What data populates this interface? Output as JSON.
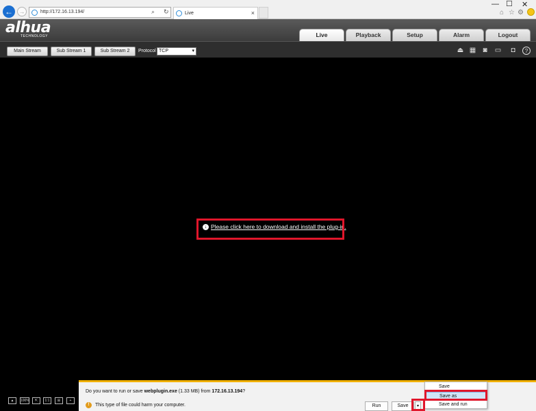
{
  "browser": {
    "url": "http://172.16.13.194/",
    "tab_title": "Live",
    "tab_close": "×",
    "back_glyph": "←",
    "forward_glyph": "→",
    "search_glyph": "⌕",
    "refresh_glyph": "↻",
    "min_glyph": "—",
    "max_glyph": "☐",
    "close_glyph": "✕",
    "home_glyph": "⌂",
    "star_glyph": "☆",
    "gear_glyph": "⚙"
  },
  "app": {
    "logo_text": "alhua",
    "logo_sub": "TECHNOLOGY",
    "nav_tabs": [
      "Live",
      "Playback",
      "Setup",
      "Alarm",
      "Logout"
    ],
    "active_tab": "Live"
  },
  "stream_bar": {
    "buttons": [
      "Main Stream",
      "Sub Stream 1",
      "Sub Stream 2"
    ],
    "protocol_label": "Protocol",
    "protocol_value": "TCP",
    "chevron": "▾",
    "right_icons": [
      "⏏",
      "▦",
      "◙",
      "▭",
      "◘",
      "?"
    ]
  },
  "video": {
    "plugin_link": "Please click here to download and install the plug-in.",
    "plugin_icon": "↓"
  },
  "bottom_controls": [
    "▲",
    "100%",
    "⇱",
    "1:1",
    "⊞",
    "+"
  ],
  "download_bar": {
    "prompt_prefix": "Do you want to run or save ",
    "file_name": "webplugin.exe",
    "file_size": " (1.33 MB) from ",
    "host": "172.16.13.194",
    "prompt_suffix": "?",
    "warning": "This type of file could harm your computer.",
    "warning_icon": "!",
    "run_label": "Run",
    "save_label": "Save",
    "dropdown_glyph": "▾"
  },
  "save_menu": {
    "items": [
      "Save",
      "Save as",
      "Save and run"
    ],
    "hovered": "Save as"
  },
  "colors": {
    "highlight": "#e0162b",
    "download_bar_accent": "#f0b000"
  }
}
